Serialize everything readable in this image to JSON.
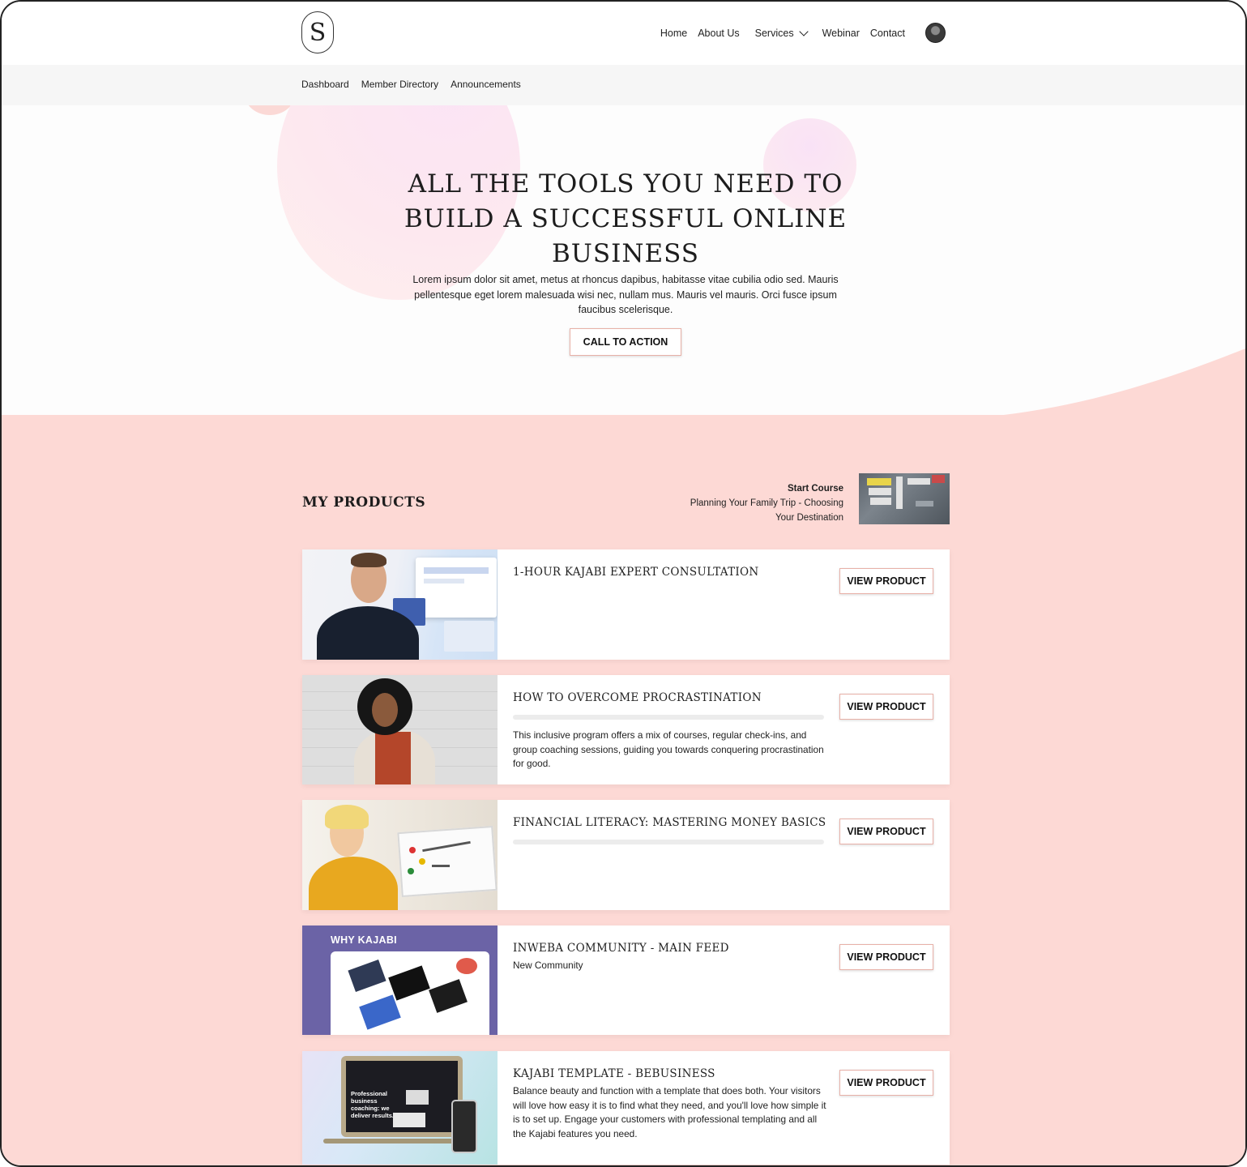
{
  "header": {
    "logo_letter": "S",
    "nav": [
      {
        "label": "Home"
      },
      {
        "label": "About Us"
      },
      {
        "label": "Services"
      },
      {
        "label": "Webinar"
      },
      {
        "label": "Contact"
      }
    ]
  },
  "subnav": {
    "items": [
      {
        "label": "Dashboard"
      },
      {
        "label": "Member Directory"
      },
      {
        "label": "Announcements"
      }
    ]
  },
  "hero": {
    "title": "ALL THE TOOLS YOU NEED TO BUILD A SUCCESSFUL ONLINE BUSINESS",
    "text": "Lorem ipsum dolor sit amet, metus at rhoncus dapibus, habitasse vitae cubilia odio sed. Mauris pellentesque eget lorem malesuada wisi nec, nullam mus. Mauris vel mauris. Orci fusce ipsum faucibus scelerisque.",
    "cta_label": "CALL TO ACTION"
  },
  "products": {
    "title": "MY PRODUCTS",
    "resume": {
      "label": "Start Course",
      "lesson": "Planning Your Family Trip - Choosing Your Destination"
    },
    "view_label": "VIEW PRODUCT",
    "items": [
      {
        "title": "1-HOUR KAJABI EXPERT CONSULTATION",
        "description": ""
      },
      {
        "title": "HOW TO OVERCOME PROCRASTINATION",
        "description": "This inclusive program offers a mix of courses, regular check-ins, and group coaching sessions, guiding you towards conquering procrastination for good."
      },
      {
        "title": "FINANCIAL LITERACY: MASTERING MONEY BASICS",
        "description": ""
      },
      {
        "title": "INWEBA COMMUNITY - MAIN FEED",
        "description": "New Community",
        "thumb_text": "WHY KAJABI"
      },
      {
        "title": "KAJABI TEMPLATE - BEBUSINESS",
        "description": "Balance beauty and function with a template that does both. Your visitors will love how easy it is to find what they need, and you'll love how simple it is to set up. Engage your customers with professional templating and all the Kajabi features you need.",
        "thumb_text": "Professional business coaching: we deliver results."
      }
    ]
  },
  "colors": {
    "accent_border": "#e8b1a8",
    "products_bg": "#fdd9d5",
    "subnav_bg": "#f6f6f6"
  },
  "icons": [
    "logo-icon",
    "chevron-down-icon",
    "avatar-icon"
  ]
}
